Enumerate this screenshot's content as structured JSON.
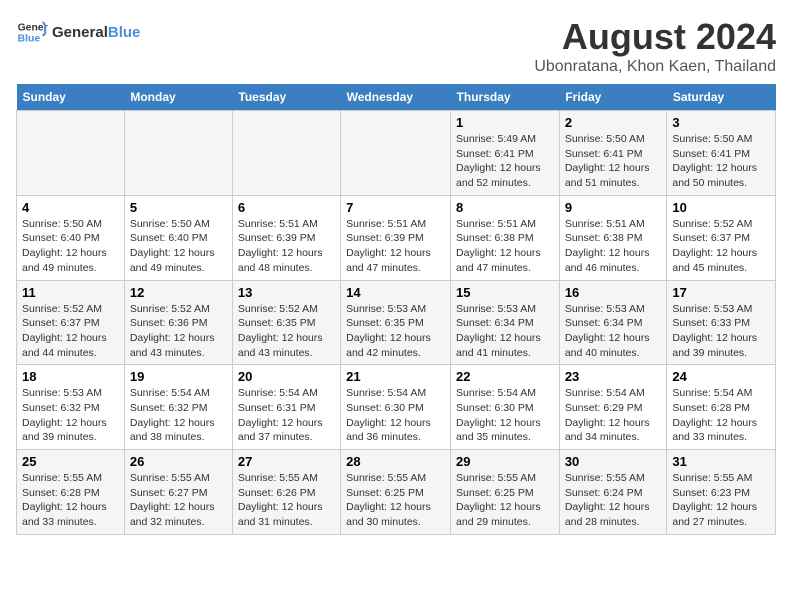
{
  "header": {
    "logo_line1": "General",
    "logo_line2": "Blue",
    "title": "August 2024",
    "subtitle": "Ubonratana, Khon Kaen, Thailand"
  },
  "weekdays": [
    "Sunday",
    "Monday",
    "Tuesday",
    "Wednesday",
    "Thursday",
    "Friday",
    "Saturday"
  ],
  "weeks": [
    [
      {
        "day": "",
        "text": ""
      },
      {
        "day": "",
        "text": ""
      },
      {
        "day": "",
        "text": ""
      },
      {
        "day": "",
        "text": ""
      },
      {
        "day": "1",
        "text": "Sunrise: 5:49 AM\nSunset: 6:41 PM\nDaylight: 12 hours\nand 52 minutes."
      },
      {
        "day": "2",
        "text": "Sunrise: 5:50 AM\nSunset: 6:41 PM\nDaylight: 12 hours\nand 51 minutes."
      },
      {
        "day": "3",
        "text": "Sunrise: 5:50 AM\nSunset: 6:41 PM\nDaylight: 12 hours\nand 50 minutes."
      }
    ],
    [
      {
        "day": "4",
        "text": "Sunrise: 5:50 AM\nSunset: 6:40 PM\nDaylight: 12 hours\nand 49 minutes."
      },
      {
        "day": "5",
        "text": "Sunrise: 5:50 AM\nSunset: 6:40 PM\nDaylight: 12 hours\nand 49 minutes."
      },
      {
        "day": "6",
        "text": "Sunrise: 5:51 AM\nSunset: 6:39 PM\nDaylight: 12 hours\nand 48 minutes."
      },
      {
        "day": "7",
        "text": "Sunrise: 5:51 AM\nSunset: 6:39 PM\nDaylight: 12 hours\nand 47 minutes."
      },
      {
        "day": "8",
        "text": "Sunrise: 5:51 AM\nSunset: 6:38 PM\nDaylight: 12 hours\nand 47 minutes."
      },
      {
        "day": "9",
        "text": "Sunrise: 5:51 AM\nSunset: 6:38 PM\nDaylight: 12 hours\nand 46 minutes."
      },
      {
        "day": "10",
        "text": "Sunrise: 5:52 AM\nSunset: 6:37 PM\nDaylight: 12 hours\nand 45 minutes."
      }
    ],
    [
      {
        "day": "11",
        "text": "Sunrise: 5:52 AM\nSunset: 6:37 PM\nDaylight: 12 hours\nand 44 minutes."
      },
      {
        "day": "12",
        "text": "Sunrise: 5:52 AM\nSunset: 6:36 PM\nDaylight: 12 hours\nand 43 minutes."
      },
      {
        "day": "13",
        "text": "Sunrise: 5:52 AM\nSunset: 6:35 PM\nDaylight: 12 hours\nand 43 minutes."
      },
      {
        "day": "14",
        "text": "Sunrise: 5:53 AM\nSunset: 6:35 PM\nDaylight: 12 hours\nand 42 minutes."
      },
      {
        "day": "15",
        "text": "Sunrise: 5:53 AM\nSunset: 6:34 PM\nDaylight: 12 hours\nand 41 minutes."
      },
      {
        "day": "16",
        "text": "Sunrise: 5:53 AM\nSunset: 6:34 PM\nDaylight: 12 hours\nand 40 minutes."
      },
      {
        "day": "17",
        "text": "Sunrise: 5:53 AM\nSunset: 6:33 PM\nDaylight: 12 hours\nand 39 minutes."
      }
    ],
    [
      {
        "day": "18",
        "text": "Sunrise: 5:53 AM\nSunset: 6:32 PM\nDaylight: 12 hours\nand 39 minutes."
      },
      {
        "day": "19",
        "text": "Sunrise: 5:54 AM\nSunset: 6:32 PM\nDaylight: 12 hours\nand 38 minutes."
      },
      {
        "day": "20",
        "text": "Sunrise: 5:54 AM\nSunset: 6:31 PM\nDaylight: 12 hours\nand 37 minutes."
      },
      {
        "day": "21",
        "text": "Sunrise: 5:54 AM\nSunset: 6:30 PM\nDaylight: 12 hours\nand 36 minutes."
      },
      {
        "day": "22",
        "text": "Sunrise: 5:54 AM\nSunset: 6:30 PM\nDaylight: 12 hours\nand 35 minutes."
      },
      {
        "day": "23",
        "text": "Sunrise: 5:54 AM\nSunset: 6:29 PM\nDaylight: 12 hours\nand 34 minutes."
      },
      {
        "day": "24",
        "text": "Sunrise: 5:54 AM\nSunset: 6:28 PM\nDaylight: 12 hours\nand 33 minutes."
      }
    ],
    [
      {
        "day": "25",
        "text": "Sunrise: 5:55 AM\nSunset: 6:28 PM\nDaylight: 12 hours\nand 33 minutes."
      },
      {
        "day": "26",
        "text": "Sunrise: 5:55 AM\nSunset: 6:27 PM\nDaylight: 12 hours\nand 32 minutes."
      },
      {
        "day": "27",
        "text": "Sunrise: 5:55 AM\nSunset: 6:26 PM\nDaylight: 12 hours\nand 31 minutes."
      },
      {
        "day": "28",
        "text": "Sunrise: 5:55 AM\nSunset: 6:25 PM\nDaylight: 12 hours\nand 30 minutes."
      },
      {
        "day": "29",
        "text": "Sunrise: 5:55 AM\nSunset: 6:25 PM\nDaylight: 12 hours\nand 29 minutes."
      },
      {
        "day": "30",
        "text": "Sunrise: 5:55 AM\nSunset: 6:24 PM\nDaylight: 12 hours\nand 28 minutes."
      },
      {
        "day": "31",
        "text": "Sunrise: 5:55 AM\nSunset: 6:23 PM\nDaylight: 12 hours\nand 27 minutes."
      }
    ]
  ]
}
